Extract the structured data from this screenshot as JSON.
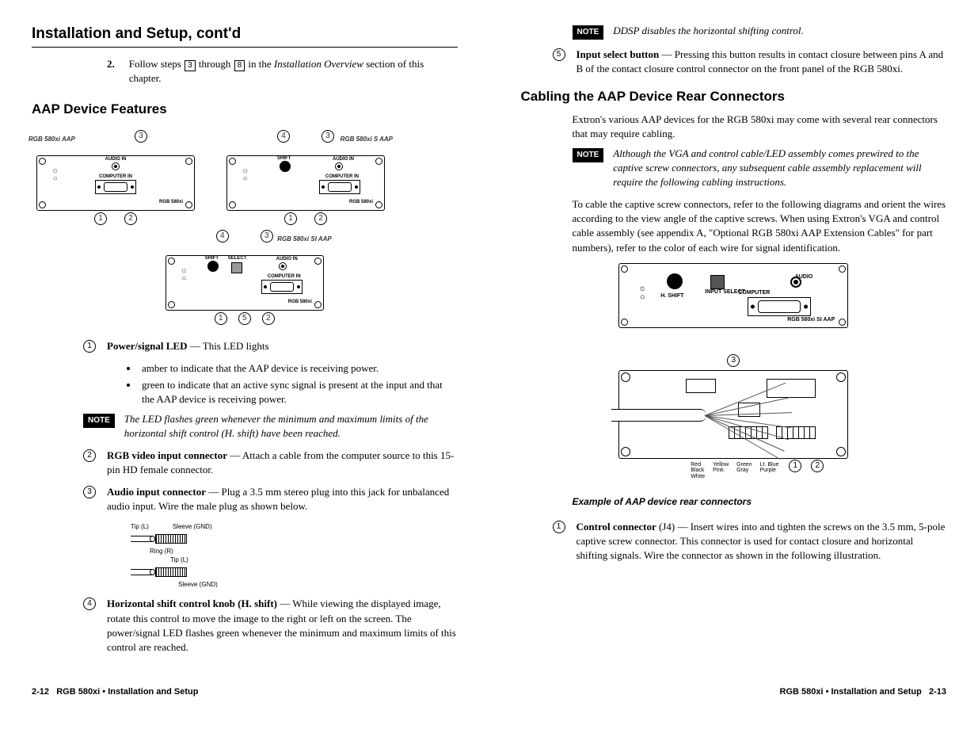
{
  "header": {
    "title": "Installation and Setup, cont'd"
  },
  "left": {
    "step": {
      "num": "2.",
      "pre": "Follow steps ",
      "box1": "3",
      "mid": " through ",
      "box2": "8",
      "post": " in the ",
      "ital": "Installation Overview",
      "after": " section of this chapter."
    },
    "features_heading": "AAP Device Features",
    "device_labels": {
      "aap": "RGB 580xi AAP",
      "s_aap": "RGB 580xi S AAP",
      "si_aap": "RGB 580xi SI AAP",
      "brand": "RGB 580xi",
      "audio_in": "AUDIO IN",
      "computer_in": "COMPUTER IN",
      "shift": "SHIFT",
      "select": "SELECT"
    },
    "features": [
      {
        "num": "1",
        "title": "Power/signal LED",
        "dash": " — This LED lights",
        "bullets": [
          "amber to indicate that the AAP device is receiving power.",
          "green to indicate that an active sync signal is present at the input and that the AAP device is receiving power."
        ],
        "note": "The LED flashes green whenever the minimum and maximum limits of the horizontal shift control (H. shift) have been reached."
      },
      {
        "num": "2",
        "title": "RGB video input connector",
        "dash": " — Attach a cable from the computer source to this 15-pin HD female connector."
      },
      {
        "num": "3",
        "title": "Audio input connector",
        "dash": " — Plug a 3.5 mm stereo plug into this jack for unbalanced audio input.  Wire the male plug as shown below."
      },
      {
        "num": "4",
        "title": "Horizontal shift control knob (H. shift)",
        "dash": " — While viewing the displayed image, rotate this control to move the image to the right or left on the screen.  The power/signal LED flashes green whenever the minimum and maximum limits of this control are reached."
      }
    ],
    "plug_labels": {
      "tip": "Tip (L)",
      "sleeve": "Sleeve (GND)",
      "ring": "Ring (R)"
    }
  },
  "right": {
    "top_note": "DDSP disables the horizontal shifting control.",
    "feature5": {
      "num": "5",
      "title": "Input select button",
      "dash": " — Pressing this button results in contact closure between pins A and B of the contact closure control connector on the front panel of the RGB 580xi."
    },
    "heading": "Cabling the AAP Device Rear Connectors",
    "intro": "Extron's various AAP devices for the RGB 580xi may come with several rear connectors that may require cabling.",
    "note": "Although the VGA and control cable/LED assembly comes prewired to the captive screw connectors, any subsequent cable assembly replacement will require the following cabling instructions.",
    "para": "To cable the captive screw connectors, refer to the following diagrams and orient the wires according to the view angle of the captive screws.  When using Extron's VGA and control cable assembly (see appendix A, \"Optional RGB 580xi AAP Extension Cables\" for part numbers), refer to the color of each wire for signal identification.",
    "rear_labels": {
      "audio": "AUDIO",
      "input_select": "INPUT SELECT",
      "computer": "COMPUTER",
      "hshift": "H. SHIFT",
      "brand": "RGB 580xi SI AAP"
    },
    "wire_colors": {
      "col1": "Red\nBlack\nWhite",
      "col2": "Yellow\nPink",
      "col3": "Green\nGray",
      "col4": "Lt. Blue\nPurple"
    },
    "example_caption": "Example of AAP device rear connectors",
    "feature1r": {
      "num": "1",
      "title": "Control connector",
      "paren": " (J4) — ",
      "text": " Insert wires into and tighten the screws on the 3.5 mm, 5-pole captive screw connector.  This connector is used for contact closure and horizontal shifting signals.  Wire the connector as shown in the following illustration."
    }
  },
  "note_label": "NOTE",
  "footer": {
    "left_page": "2-12",
    "right_page": "2-13",
    "title": "RGB 580xi • Installation and Setup"
  }
}
